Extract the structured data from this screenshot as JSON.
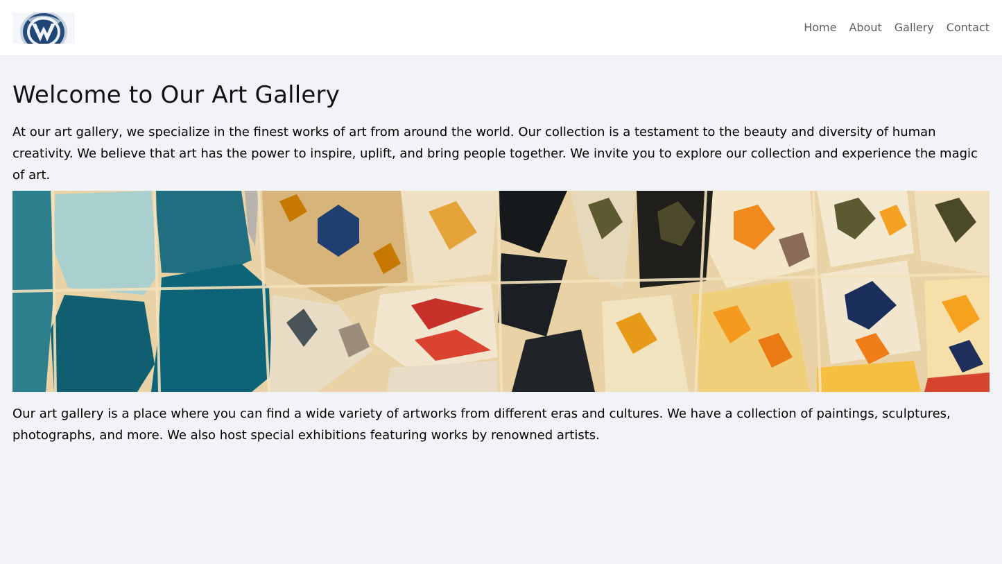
{
  "header": {
    "logo_icon": "volkswagen-logo-icon",
    "nav": [
      {
        "label": "Home"
      },
      {
        "label": "About"
      },
      {
        "label": "Gallery"
      },
      {
        "label": "Contact"
      }
    ]
  },
  "main": {
    "title": "Welcome to Our Art Gallery",
    "intro": "At our art gallery, we specialize in the finest works of art from around the world. Our collection is a testament to the beauty and diversity of human creativity. We believe that art has the power to inspire, uplift, and bring people together. We invite you to explore our collection and experience the magic of art.",
    "hero_image": "mosaic-tiles-image",
    "description": "Our art gallery is a place where you can find a wide variety of artworks from different eras and cultures. We have a collection of paintings, sculptures, photographs, and more. We also host special exhibitions featuring works by renowned artists."
  },
  "colors": {
    "background": "#f2f3f6",
    "header": "#ffffff",
    "nav_text": "#5a5d63",
    "text": "#000000"
  }
}
